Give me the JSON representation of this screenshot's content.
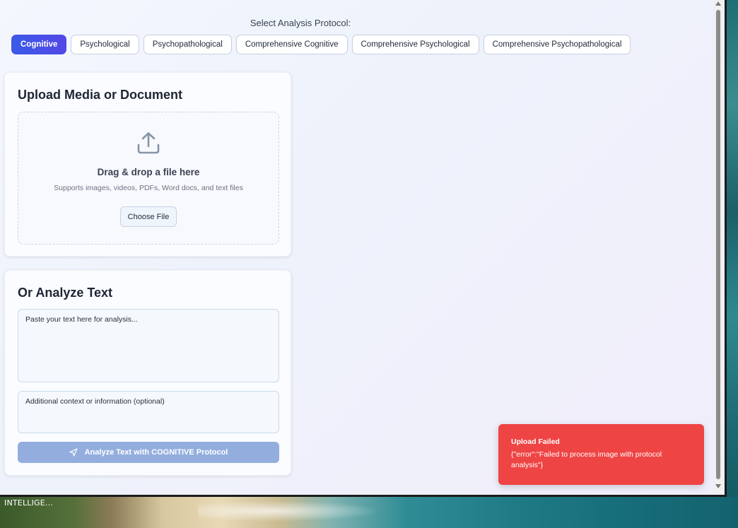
{
  "protocol": {
    "heading": "Select Analysis Protocol:",
    "tabs": [
      {
        "label": "Cognitive",
        "active": true
      },
      {
        "label": "Psychological",
        "active": false
      },
      {
        "label": "Psychopathological",
        "active": false
      },
      {
        "label": "Comprehensive Cognitive",
        "active": false
      },
      {
        "label": "Comprehensive Psychological",
        "active": false
      },
      {
        "label": "Comprehensive Psychopathological",
        "active": false
      }
    ]
  },
  "upload": {
    "title": "Upload Media or Document",
    "drop_title": "Drag & drop a file here",
    "drop_subtitle": "Supports images, videos, PDFs, Word docs, and text files",
    "choose_button": "Choose File",
    "icon": "upload-icon"
  },
  "text_analysis": {
    "title": "Or Analyze Text",
    "text_placeholder": "Paste your text here for analysis...",
    "context_placeholder": "Additional context or information (optional)",
    "analyze_button": "Analyze Text with COGNITIVE Protocol",
    "icon": "send-icon"
  },
  "toast": {
    "title": "Upload Failed",
    "message": "{\"error\":\"Failed to process image with protocol analysis\"}"
  },
  "taskbar": {
    "label": "INTELLIGE..."
  },
  "colors": {
    "accent": "#3b5ae8",
    "error": "#ef4444",
    "disabled_button": "#93aede"
  }
}
